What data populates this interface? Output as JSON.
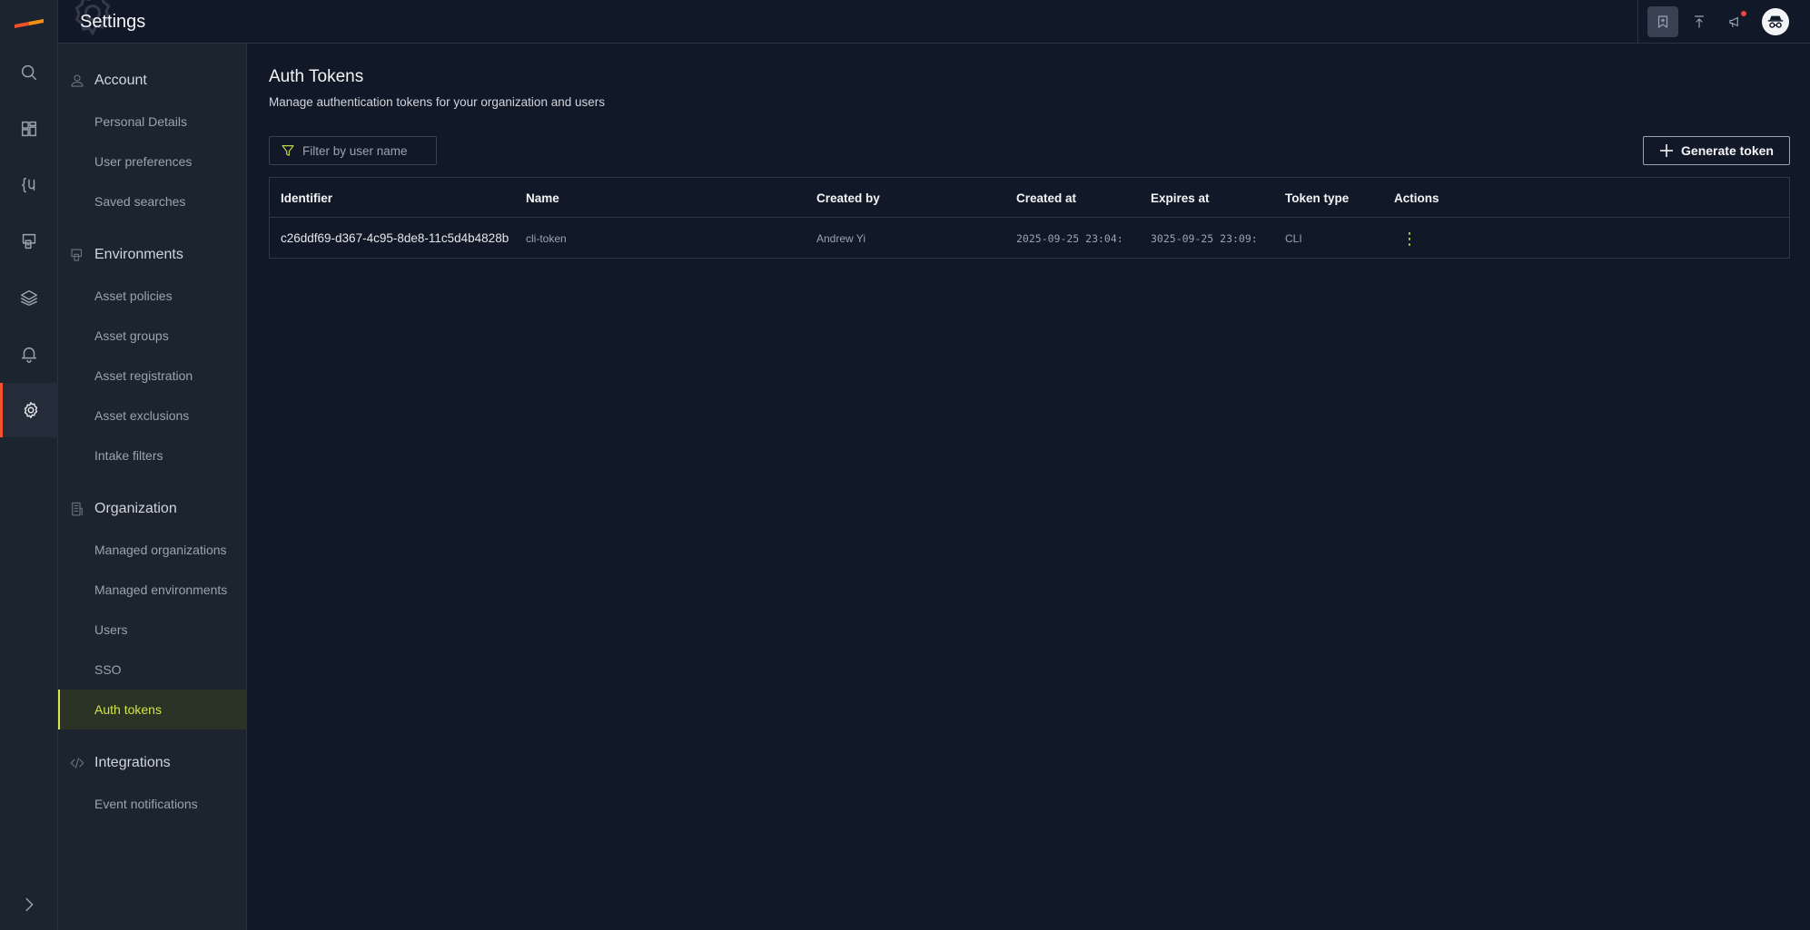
{
  "topbar": {
    "title": "Settings"
  },
  "rail": {
    "items": [
      "search-icon",
      "dashboard-icon",
      "query-icon",
      "assets-icon",
      "layers-icon",
      "bell-icon",
      "settings-icon"
    ],
    "expand_icon": "chevron-right-icon",
    "accent_color": "#f0532b"
  },
  "settings_nav": {
    "sections": [
      {
        "label": "Account",
        "icon": "user-icon",
        "items": [
          "Personal Details",
          "User preferences",
          "Saved searches"
        ]
      },
      {
        "label": "Environments",
        "icon": "environments-icon",
        "items": [
          "Asset policies",
          "Asset groups",
          "Asset registration",
          "Asset exclusions",
          "Intake filters"
        ]
      },
      {
        "label": "Organization",
        "icon": "building-icon",
        "items": [
          "Managed organizations",
          "Managed environments",
          "Users",
          "SSO",
          "Auth tokens"
        ]
      },
      {
        "label": "Integrations",
        "icon": "code-icon",
        "items": [
          "Event notifications"
        ]
      }
    ],
    "active_item": "Auth tokens",
    "active_color": "#d4e64a"
  },
  "main": {
    "title": "Auth Tokens",
    "subtitle": "Manage authentication tokens for your organization and users",
    "filter_placeholder": "Filter by user name",
    "generate_label": "Generate token",
    "table": {
      "headers": [
        "Identifier",
        "Name",
        "Created by",
        "Created at",
        "Expires at",
        "Token type",
        "Actions"
      ],
      "rows": [
        {
          "identifier": "c26ddf69-d367-4c95-8de8-11c5d4b4828b",
          "name": "cli-token",
          "created_by": "Andrew Yi",
          "created_at": "2025-09-25 23:04:",
          "expires_at": "3025-09-25 23:09:",
          "token_type": "CLI"
        }
      ]
    }
  }
}
